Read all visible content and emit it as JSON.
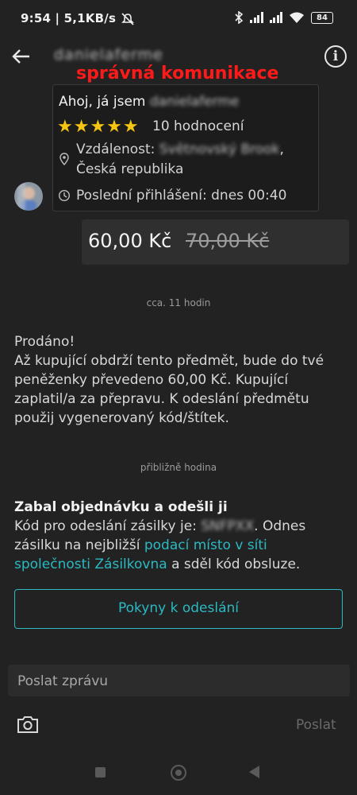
{
  "status_bar": {
    "time_speed": "9:54 | 5,1KB/s",
    "battery": "84",
    "icons": [
      "mute-icon",
      "bluetooth-icon",
      "signal-icon",
      "signal-icon",
      "wifi-icon",
      "battery-icon"
    ]
  },
  "header": {
    "username": "danielaferme",
    "annotation": "správná komunikace",
    "icons": [
      "back-arrow-icon",
      "info-icon"
    ]
  },
  "profile_card": {
    "greeting": "Ahoj, já jsem",
    "greeting_name": "danielaferme",
    "stars": "★★★★★",
    "rating_text": "10 hodnocení",
    "location_label": "Vzdálenost:",
    "location_city": "Světnovský Brook",
    "location_suffix": ",",
    "location_country": "Česká republika",
    "last_login": "Poslední přihlášení: dnes 00:40",
    "star_color": "#f6c511"
  },
  "price": {
    "current": "60,00 Kč",
    "old": "70,00 Kč"
  },
  "messages": {
    "time1": "cca. 11 hodin",
    "sold_title": "Prodáno!",
    "sold_body": "Až kupující obdrží tento předmět, bude do tvé peněženky převedeno 60,00 Kč. Kupující zaplatil/a za přepravu. K odeslání předmětu použij vygenerovaný kód/štítek.",
    "time2": "přibližně hodina",
    "ship_title": "Zabal objednávku a odešli ji",
    "ship_code_label": "Kód pro odeslání zásilky je:",
    "ship_code": "SNFPXX",
    "ship_text_a": ". Odnes zásilku na nejbližší",
    "ship_link": "podací místo v síti společnosti Zásilkovna",
    "ship_text_b": "a sděl kód obsluze."
  },
  "actions": {
    "pokyny_label": "Pokyny k odeslání",
    "input_placeholder": "Poslat zprávu",
    "send_label": "Poslat"
  },
  "colors": {
    "accent": "#2bb9c2",
    "background": "#222222",
    "annotation_red": "#ff1a1a"
  }
}
